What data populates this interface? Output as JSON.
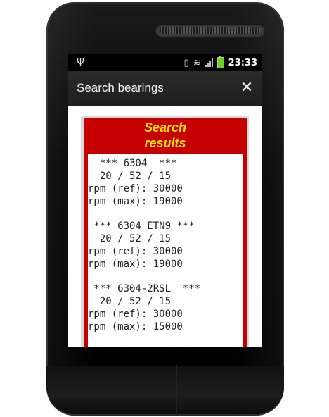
{
  "status_bar": {
    "time": "23:33",
    "icons": [
      "usb-icon",
      "vibrate-icon",
      "wifi-icon",
      "signal-icon",
      "battery-icon"
    ]
  },
  "dialog": {
    "title": "Search bearings",
    "close_icon": "close-icon"
  },
  "card": {
    "title_line1": "Search",
    "title_line2": "results"
  },
  "results": [
    {
      "line1": "  *** 6304  ***",
      "line2": "  20 / 52 / 15",
      "line3": "rpm (ref): 30000",
      "line4": "rpm (max): 19000"
    },
    {
      "line1": " *** 6304 ETN9 ***",
      "line2": "  20 / 52 / 15",
      "line3": "rpm (ref): 30000",
      "line4": "rpm (max): 19000"
    },
    {
      "line1": " *** 6304-2RSL  ***",
      "line2": "  20 / 52 / 15",
      "line3": "rpm (ref): 30000",
      "line4": "rpm (max): 15000"
    }
  ],
  "colors": {
    "card_red": "#c60000",
    "title_yellow": "#ffe200",
    "battery_green": "#6fcf2a"
  }
}
